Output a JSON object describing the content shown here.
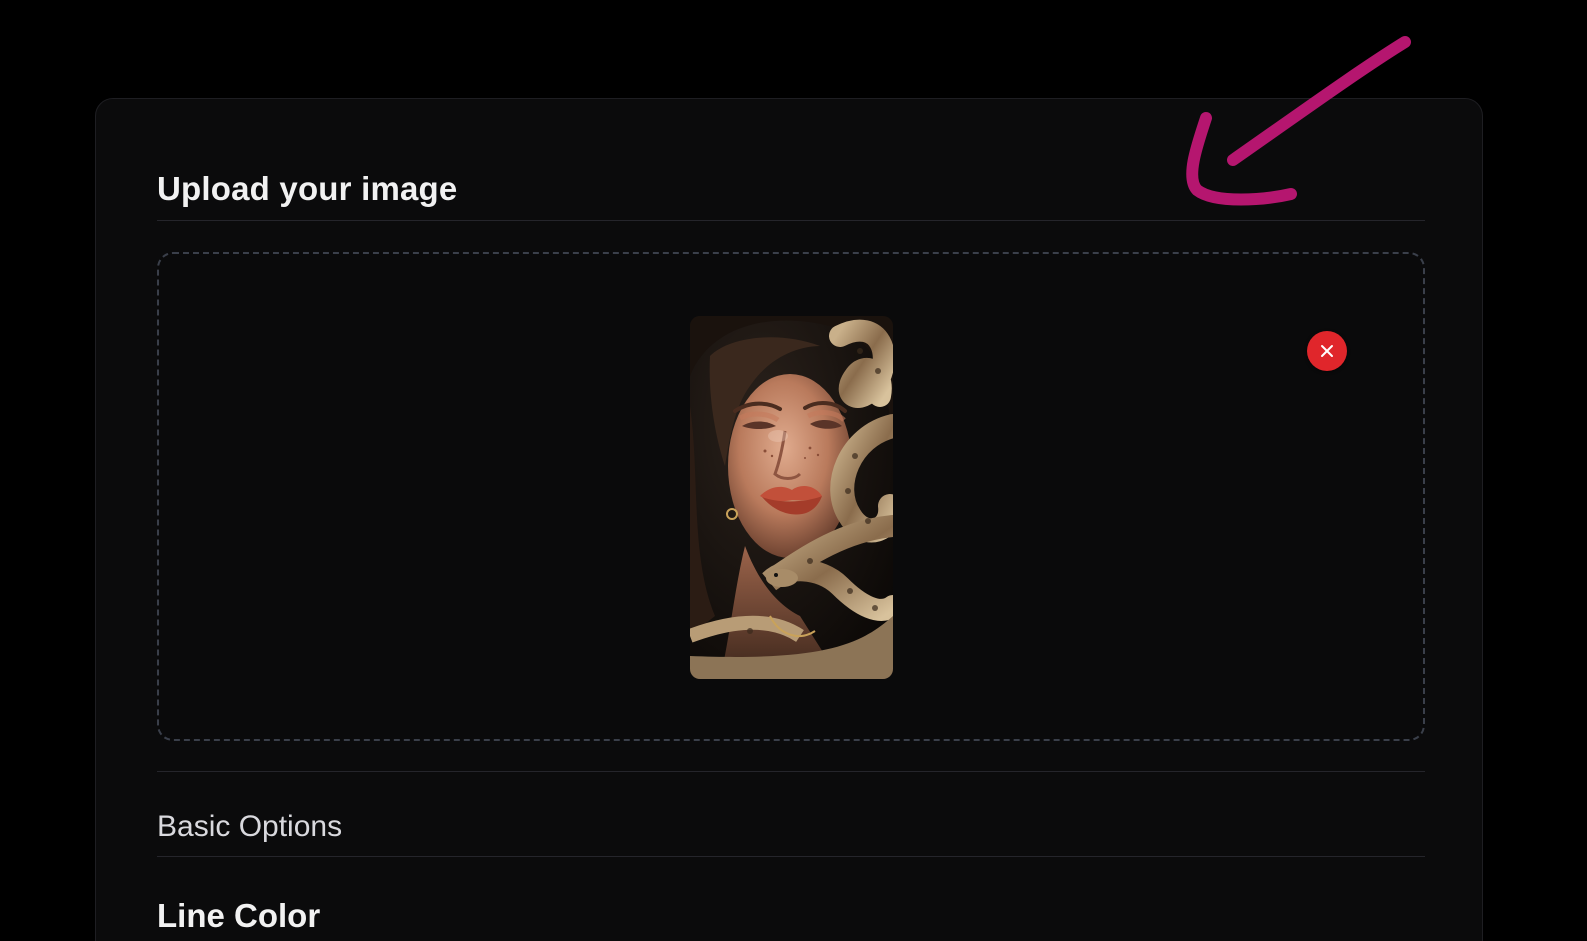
{
  "upload": {
    "title": "Upload your image",
    "preview_alt": "Uploaded portrait preview",
    "remove_button_label": "×"
  },
  "options": {
    "basic_label": "Basic Options",
    "line_color_label": "Line Color"
  },
  "icons": {
    "remove": "close-icon",
    "annotation": "arrow-annotation-icon"
  },
  "colors": {
    "background": "#000000",
    "card": "#0b0b0c",
    "remove_button": "#e0262b",
    "annotation_arrow": "#b5166f",
    "dashed_border": "#3a3f4a"
  }
}
